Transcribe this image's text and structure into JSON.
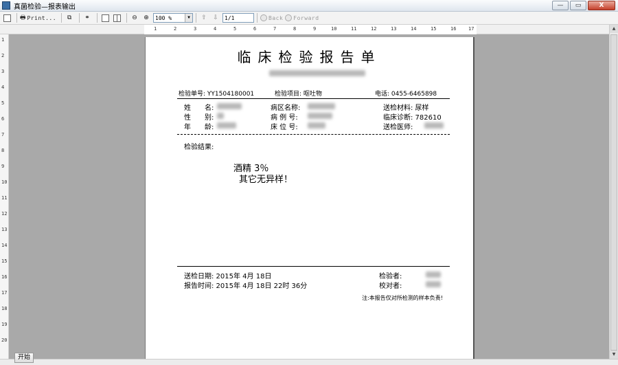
{
  "window": {
    "title": "真菌检验—报表输出",
    "controls": [
      "—",
      "▭",
      "X"
    ]
  },
  "toolbar": {
    "print_label": "Print...",
    "zoom_value": "100 %",
    "page_value": "1/1",
    "back_label": "Back",
    "forward_label": "Forward"
  },
  "ruler": {
    "top_numbers": [
      "1",
      "2",
      "3",
      "4",
      "5",
      "6",
      "7",
      "8",
      "9",
      "10",
      "11",
      "12",
      "13",
      "14",
      "15",
      "16",
      "17"
    ],
    "left_numbers": [
      "1",
      "2",
      "3",
      "4",
      "5",
      "6",
      "7",
      "8",
      "9",
      "10",
      "11",
      "12",
      "13",
      "14",
      "15",
      "16",
      "17",
      "18",
      "19",
      "20"
    ]
  },
  "report": {
    "title": "临床检验报告单",
    "header": {
      "sample_no": "检验单号: YY1504180001",
      "item": "检验项目: 呕吐物",
      "phone": "电话: 0455-6465898"
    },
    "patient": {
      "name_label": "姓　　名:",
      "gender_label": "性　　别:",
      "age_label": "年　　龄:",
      "ward_label": "病区名称:",
      "case_label": "病 例 号:",
      "bed_label": "床 位 号:",
      "specimen": "送检材料: 尿样",
      "diagnosis": "临床诊断: 782610",
      "doctor_label": "送检医师:"
    },
    "results_label": "检验结果:",
    "results": [
      "酒精 3％",
      "其它无异样！"
    ],
    "footer": {
      "send_date": "送检日期: 2015年 4月 18日",
      "report_time": "报告时间: 2015年 4月 18日 22时 36分",
      "inspector_label": "检验者:",
      "checker_label": "校对者:",
      "note": "注:本报告仅对所检测的样本负责!"
    }
  },
  "taskbar": {
    "start_label": "开始"
  }
}
